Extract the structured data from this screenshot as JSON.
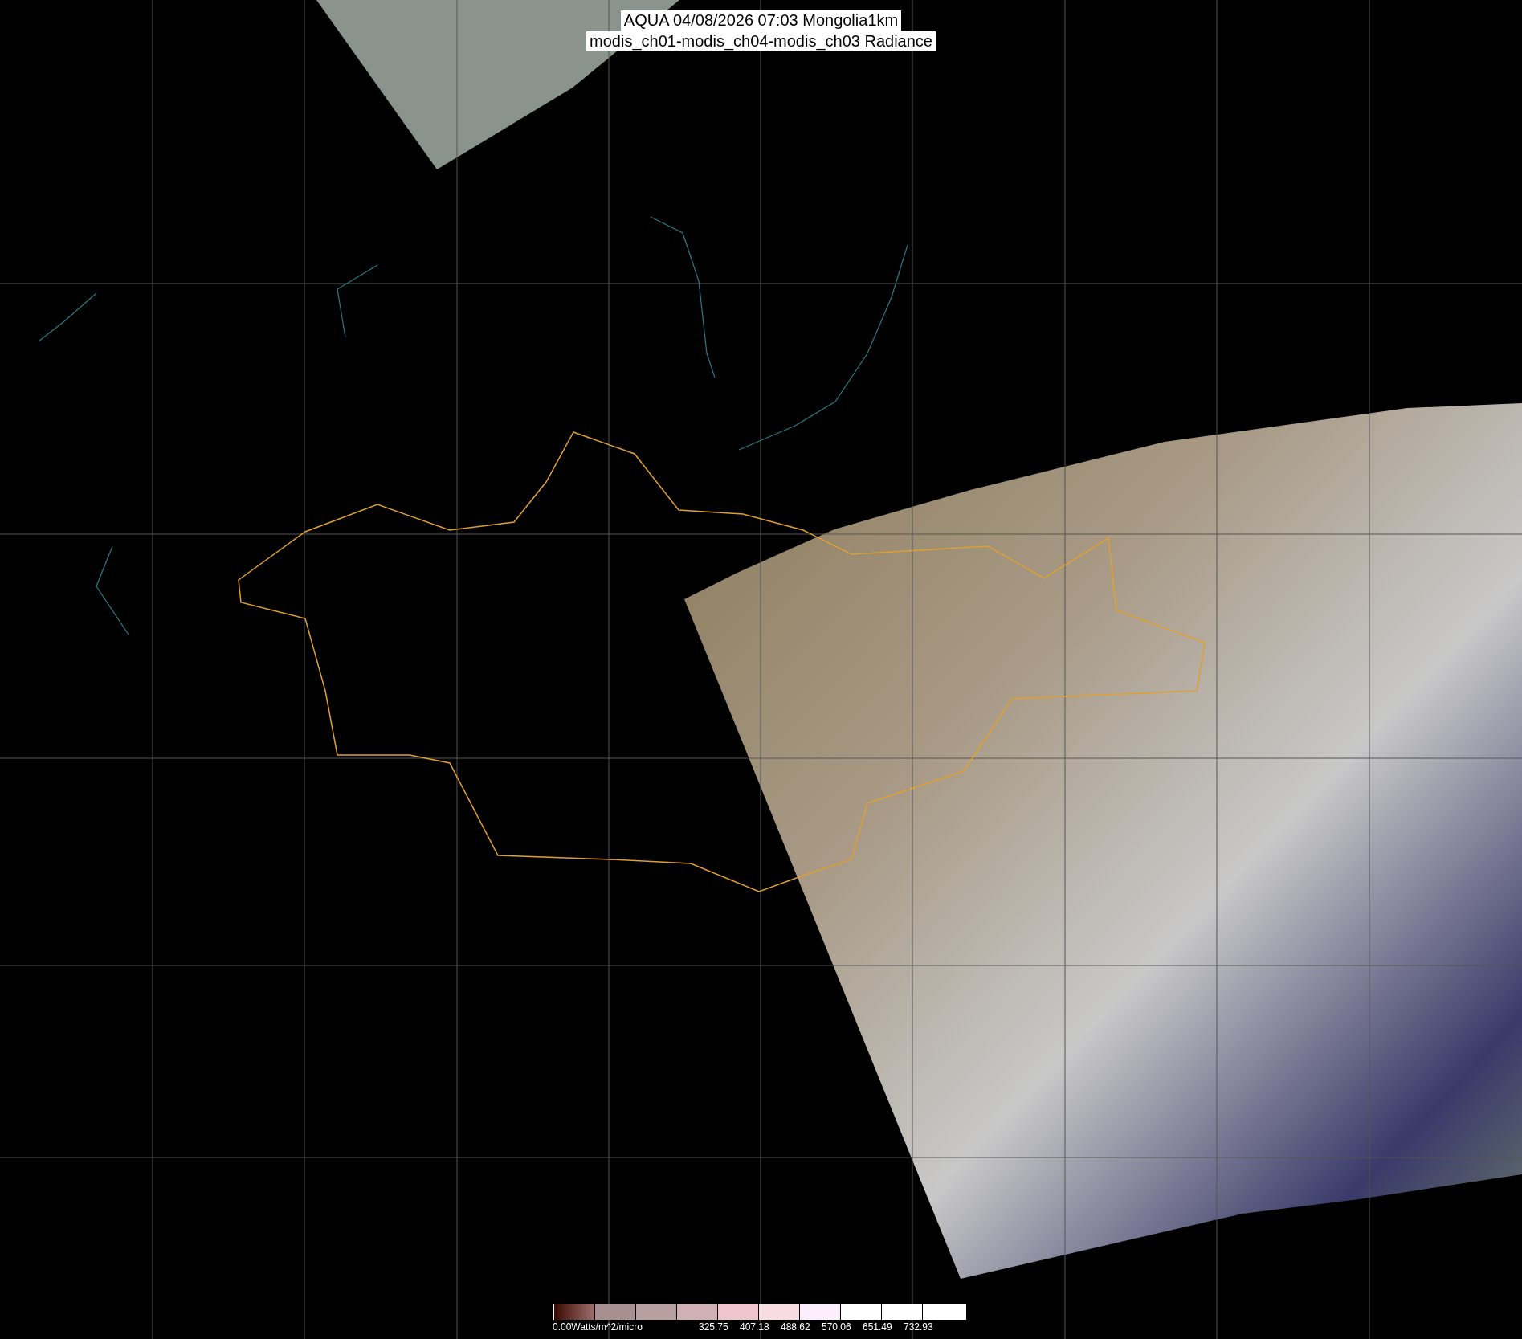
{
  "title": {
    "line_1": "AQUA 04/08/2026 07:03 Mongolia1km",
    "line_2": "modis_ch01-modis_ch04-modis_ch03 Radiance"
  },
  "legend": {
    "unit_label": "0.00Watts/m^2/micro",
    "tick_labels": [
      "325.75",
      "407.18",
      "488.62",
      "570.06",
      "651.49",
      "732.93"
    ]
  }
}
